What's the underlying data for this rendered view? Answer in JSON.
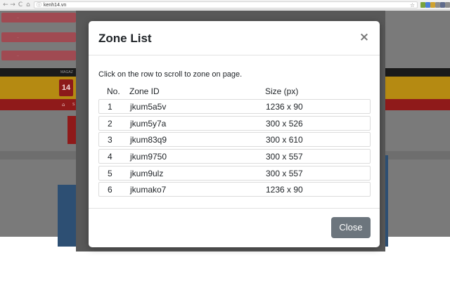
{
  "browser": {
    "url": "kenh14.vn",
    "back_icon": "←",
    "forward_icon": "→",
    "reload_icon": "C",
    "home_icon": "⌂",
    "info_icon": "ⓘ",
    "star_icon": "☆",
    "extension_colors": [
      "#7aa33b",
      "#4c7fd6",
      "#d0a22e",
      "#8d8d8d",
      "#5f6b8c",
      "#8d8d8d"
    ]
  },
  "background_page": {
    "pink_items": [
      "...",
      "...",
      "..."
    ],
    "nav_label": "MAGAZ",
    "logo_text": "14",
    "redbar_icon": "⌂",
    "redbar_label": "S"
  },
  "modal": {
    "title": "Zone List",
    "close_icon": "×",
    "instruction": "Click on the row to scroll to zone on page.",
    "columns": {
      "no": "No.",
      "zone_id": "Zone ID",
      "size": "Size (px)"
    },
    "rows": [
      {
        "no": "1",
        "zone_id": "jkum5a5v",
        "size": "1236 x 90"
      },
      {
        "no": "2",
        "zone_id": "jkum5y7a",
        "size": "300 x 526"
      },
      {
        "no": "3",
        "zone_id": "jkum83q9",
        "size": "300 x 610"
      },
      {
        "no": "4",
        "zone_id": "jkum9750",
        "size": "300 x 557"
      },
      {
        "no": "5",
        "zone_id": "jkum9ulz",
        "size": "300 x 557"
      },
      {
        "no": "6",
        "zone_id": "jkumako7",
        "size": "1236 x 90"
      }
    ],
    "close_button_label": "Close"
  },
  "colors": {
    "close_button": "#6c757d",
    "overlay": "#7a7a7a",
    "brand_red": "#8f1a1a",
    "brand_gold": "#b58a12"
  }
}
